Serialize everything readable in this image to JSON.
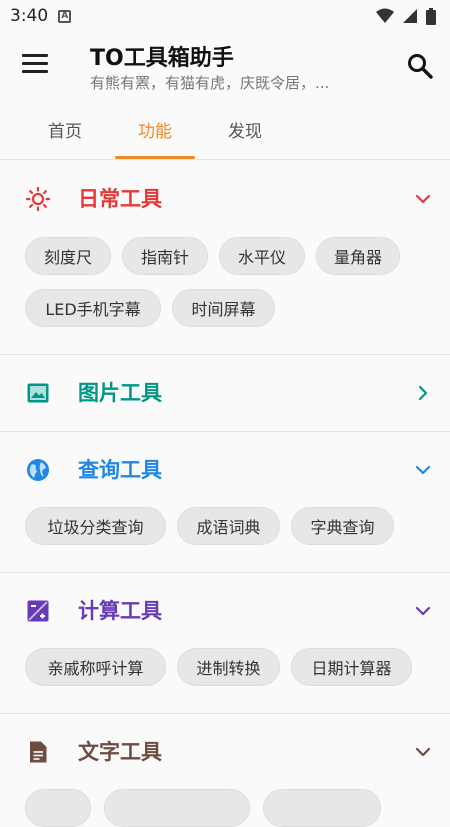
{
  "status_bar": {
    "time": "3:40",
    "notification_letter": "A"
  },
  "app_bar": {
    "title": "TO工具箱助手",
    "subtitle": "有熊有罴，有猫有虎，庆既令居，..."
  },
  "tabs": [
    {
      "label": "首页"
    },
    {
      "label": "功能"
    },
    {
      "label": "发现"
    }
  ],
  "active_tab": "功能",
  "colors": {
    "accent": "#f08a24",
    "daily": "#e53935",
    "image": "#009688",
    "query": "#1e88e5",
    "calc": "#673ab7",
    "text": "#6d4c41"
  },
  "sections": [
    {
      "title": "日常工具",
      "icon": "sun-icon",
      "chevron": "chevron-down-icon",
      "chips": [
        "刻度尺",
        "指南针",
        "水平仪",
        "量角器",
        "LED手机字幕",
        "时间屏幕"
      ]
    },
    {
      "title": "图片工具",
      "icon": "image-icon",
      "chevron": "chevron-right-icon",
      "chips": []
    },
    {
      "title": "查询工具",
      "icon": "globe-icon",
      "chevron": "chevron-down-icon",
      "chips": [
        "垃圾分类查询",
        "成语词典",
        "字典查询"
      ]
    },
    {
      "title": "计算工具",
      "icon": "calculator-icon",
      "chevron": "chevron-down-icon",
      "chips": [
        "亲戚称呼计算",
        "进制转换",
        "日期计算器"
      ]
    },
    {
      "title": "文字工具",
      "icon": "document-icon",
      "chevron": "chevron-down-icon",
      "chips": []
    }
  ]
}
